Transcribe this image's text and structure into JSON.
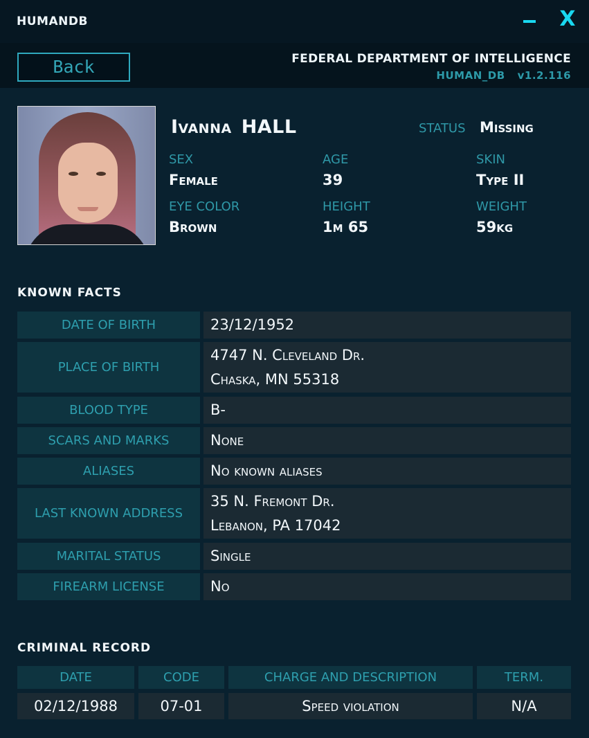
{
  "window": {
    "title": "HUMANDB",
    "minimize_glyph": "–",
    "close_glyph": "X"
  },
  "header": {
    "back_label": "Back",
    "agency": "FEDERAL DEPARTMENT OF INTELLIGENCE",
    "app_name": "HUMAN_DB",
    "version": "v1.2.116"
  },
  "profile": {
    "first_name": "Ivanna",
    "last_name": "HALL",
    "status_label": "STATUS",
    "status": "Missing",
    "attributes": [
      {
        "label": "SEX",
        "value": "Female"
      },
      {
        "label": "AGE",
        "value": "39"
      },
      {
        "label": "SKIN",
        "value": "Type II"
      },
      {
        "label": "EYE COLOR",
        "value": "Brown"
      },
      {
        "label": "HEIGHT",
        "value": "1m 65"
      },
      {
        "label": "WEIGHT",
        "value": "59kg"
      }
    ]
  },
  "known_facts": {
    "title": "KNOWN  FACTS",
    "rows": [
      {
        "label": "DATE OF BIRTH",
        "lines": [
          "23/12/1952"
        ]
      },
      {
        "label": "PLACE OF BIRTH",
        "lines": [
          "4747 N. Cleveland Dr.",
          "Chaska, MN 55318"
        ]
      },
      {
        "label": "BLOOD TYPE",
        "lines": [
          "B-"
        ]
      },
      {
        "label": "SCARS AND MARKS",
        "lines": [
          "None"
        ]
      },
      {
        "label": "ALIASES",
        "lines": [
          "No known aliases"
        ]
      },
      {
        "label": "LAST KNOWN ADDRESS",
        "lines": [
          "35 N. Fremont Dr.",
          "Lebanon, PA 17042"
        ]
      },
      {
        "label": "MARITAL STATUS",
        "lines": [
          "Single"
        ]
      },
      {
        "label": "FIREARM LICENSE",
        "lines": [
          "No"
        ]
      }
    ]
  },
  "criminal_record": {
    "title": "CRIMINAL  RECORD",
    "columns": [
      "DATE",
      "CODE",
      "CHARGE AND DESCRIPTION",
      "TERM."
    ],
    "rows": [
      [
        "02/12/1988",
        "07-01",
        "Speed violation",
        "N/A"
      ]
    ]
  },
  "colors": {
    "accent": "#19d8f0",
    "label": "#2f98a7",
    "background": "#09212f"
  }
}
